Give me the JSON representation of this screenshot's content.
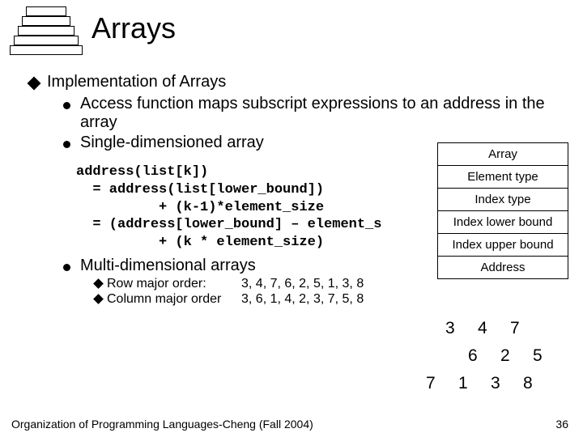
{
  "title": "Arrays",
  "heading": "Implementation of Arrays",
  "bullets": {
    "b1": "Access function maps subscript expressions to an address in the array",
    "b2": "Single-dimensioned array",
    "b3": "Multi-dimensional arrays"
  },
  "code": "address(list[k])\n  = address(list[lower_bound])\n          + (k-1)*element_size\n  = (address[lower_bound] – element_s\n          + (k * element_size)",
  "descriptor": {
    "r1": "Array",
    "r2": "Element type",
    "r3": "Index type",
    "r4": "Index lower bound",
    "r5": "Index upper bound",
    "r6": "Address"
  },
  "orders": {
    "row_label": "Row major order:",
    "row_values": "3, 4, 7, 6, 2, 5, 1, 3, 8",
    "col_label": "Column major order",
    "col_values": "3, 6, 1, 4, 2, 3, 7, 5, 8"
  },
  "matrix": {
    "r1c1": "3",
    "r1c2": "4",
    "r1c3": "7",
    "r2c1": "6",
    "r2c2": "2",
    "r2c3": "5",
    "r3c1": "1",
    "r3c2": "3",
    "r3c3": "8"
  },
  "matrix_extra": "7",
  "footer": "Organization of Programming Languages-Cheng (Fall 2004)",
  "page": "36"
}
